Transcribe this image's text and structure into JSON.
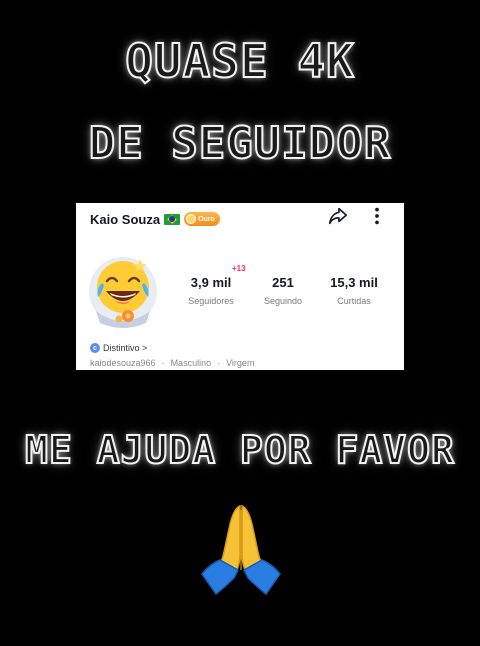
{
  "overlay": {
    "line1": "QUASE 4K",
    "line2": "DE SEGUIDOR",
    "line3": "ME AJUDA POR FAVOR"
  },
  "profile": {
    "username": "Kaio Souza",
    "badge_label": "Ouro",
    "new_followers": "+13",
    "stats": {
      "followers_value": "3,9 mil",
      "followers_label": "Seguidores",
      "following_value": "251",
      "following_label": "Seguindo",
      "likes_value": "15,3 mil",
      "likes_label": "Curtidas"
    },
    "distintivo": "Distintivo >",
    "handle": "kaiodesouza966",
    "separator": "·",
    "gender": "Masculino",
    "sign": "Virgem"
  },
  "icons": {
    "share": "share-icon",
    "more": "more-vertical-icon",
    "flag": "brazil-flag-icon",
    "avatar": "laughing-emoji-avatar",
    "pray": "praying-hands-emoji"
  },
  "colors": {
    "background": "#000000",
    "card": "#ffffff",
    "badge": "#f08c1e",
    "accent": "#fe2c55"
  }
}
